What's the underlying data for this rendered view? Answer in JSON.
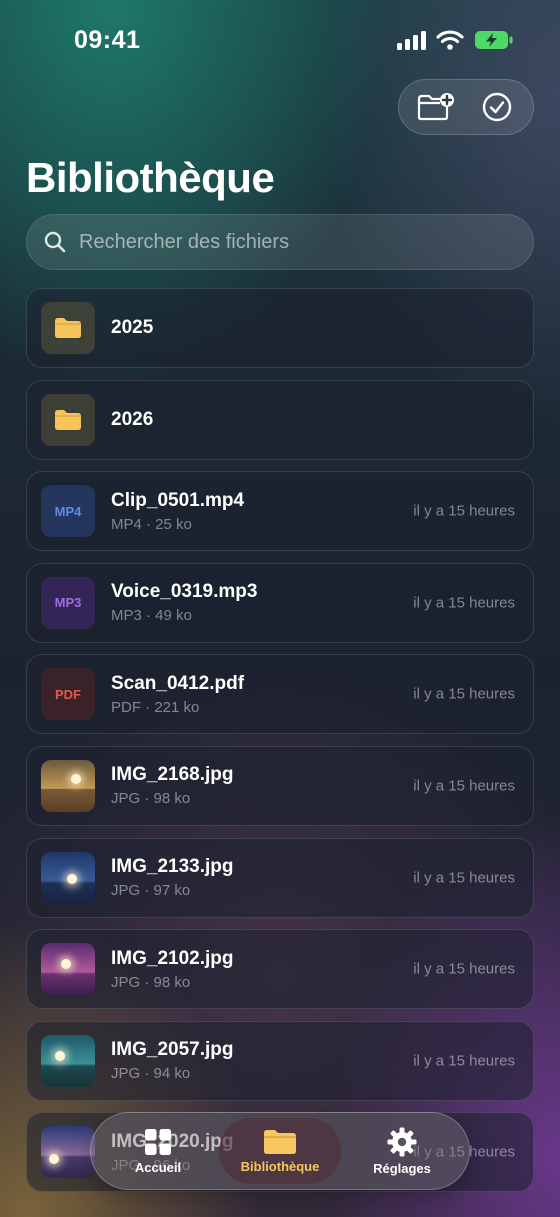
{
  "status_bar": {
    "time": "09:41"
  },
  "page": {
    "title": "Bibliothèque"
  },
  "search": {
    "placeholder": "Rechercher des fichiers"
  },
  "items": [
    {
      "kind": "folder",
      "name": "2025",
      "meta": "",
      "time": ""
    },
    {
      "kind": "folder",
      "name": "2026",
      "meta": "",
      "time": ""
    },
    {
      "kind": "mp4",
      "badge": "MP4",
      "name": "Clip_0501.mp4",
      "meta": "MP4 · 25 ko",
      "time": "il y a 15 heures"
    },
    {
      "kind": "mp3",
      "badge": "MP3",
      "name": "Voice_0319.mp3",
      "meta": "MP3 · 49 ko",
      "time": "il y a 15 heures"
    },
    {
      "kind": "pdf",
      "badge": "PDF",
      "name": "Scan_0412.pdf",
      "meta": "PDF · 221 ko",
      "time": "il y a 15 heures"
    },
    {
      "kind": "image",
      "name": "IMG_2168.jpg",
      "meta": "JPG · 98 ko",
      "time": "il y a 15 heures"
    },
    {
      "kind": "image",
      "name": "IMG_2133.jpg",
      "meta": "JPG · 97 ko",
      "time": "il y a 15 heures"
    },
    {
      "kind": "image",
      "name": "IMG_2102.jpg",
      "meta": "JPG · 98 ko",
      "time": "il y a 15 heures"
    },
    {
      "kind": "image",
      "name": "IMG_2057.jpg",
      "meta": "JPG · 94 ko",
      "time": "il y a 15 heures"
    },
    {
      "kind": "image",
      "name": "IMG_2020.jpg",
      "meta": "JPG · 96 ko",
      "time": "il y a 15 heures"
    }
  ],
  "tabs": [
    {
      "label": "Accueil",
      "icon": "grid-icon"
    },
    {
      "label": "Bibliothèque",
      "icon": "folder-icon",
      "active": true
    },
    {
      "label": "Réglages",
      "icon": "gear-icon"
    }
  ],
  "colors": {
    "accent": "#f6c760",
    "folder": "#f6c45a",
    "battery": "#4cd964"
  }
}
